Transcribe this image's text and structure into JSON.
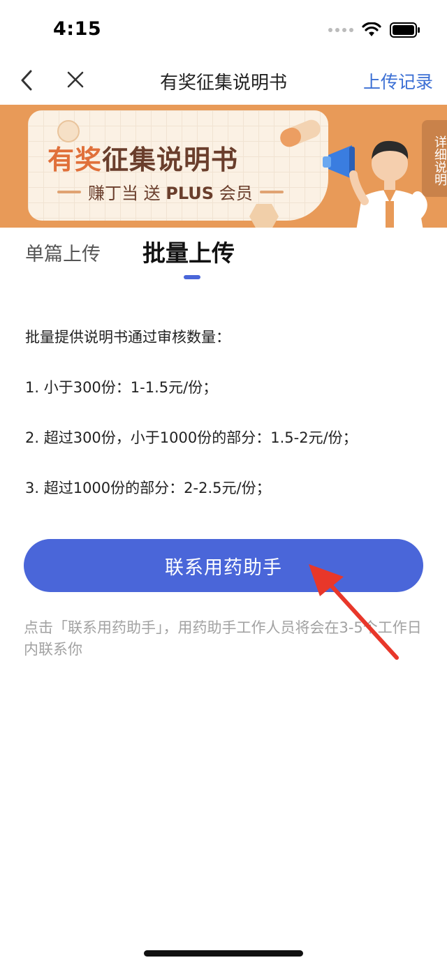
{
  "status": {
    "time": "4:15"
  },
  "nav": {
    "title": "有奖征集说明书",
    "action": "上传记录"
  },
  "banner": {
    "title_part1": "有奖",
    "title_part2": "征集说明书",
    "subtitle_prefix": "赚丁当 送 ",
    "subtitle_bold": "PLUS",
    "subtitle_suffix": " 会员",
    "side_label": "详细说明",
    "colors": {
      "background": "#e89a58",
      "scroll": "#fbf1e4",
      "accent": "#e0703a"
    }
  },
  "tabs": [
    {
      "label": "单篇上传",
      "active": false
    },
    {
      "label": "批量上传",
      "active": true
    }
  ],
  "content": {
    "intro": "批量提供说明书通过审核数量：",
    "items": [
      "1. 小于300份：1-1.5元/份；",
      "2. 超过300份，小于1000份的部分：1.5-2元/份；",
      "3. 超过1000份的部分：2-2.5元/份；"
    ]
  },
  "button": {
    "label": "联系用药助手",
    "color": "#4a66d9"
  },
  "note": "点击「联系用药助手」，用药助手工作人员将会在3-5个工作日内联系你",
  "icons": [
    "back-icon",
    "close-icon",
    "wifi-icon",
    "battery-icon",
    "megaphone-icon",
    "arrow-annotation-icon"
  ]
}
